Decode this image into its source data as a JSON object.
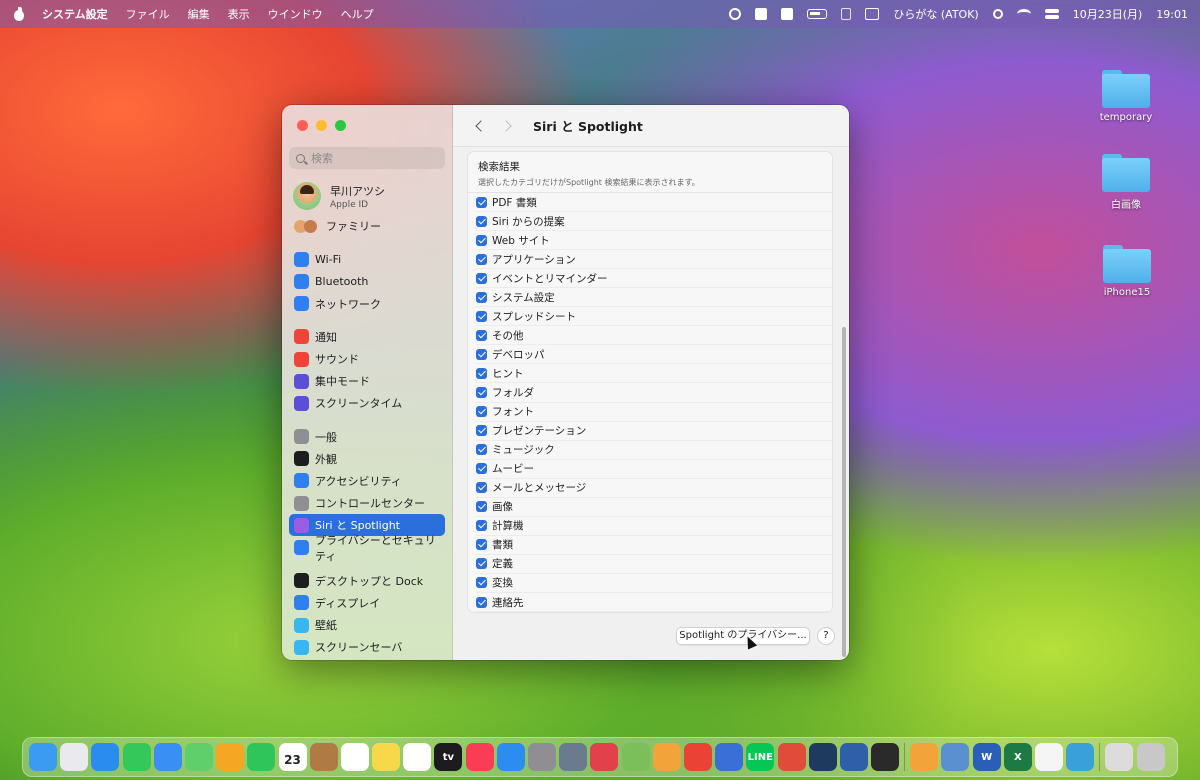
{
  "menubar": {
    "app": "システム設定",
    "items": [
      "ファイル",
      "編集",
      "表示",
      "ウインドウ",
      "ヘルプ"
    ],
    "input_method": "ひらがな (ATOK)",
    "date": "10月23日(月)",
    "time": "19:01"
  },
  "desktop": {
    "icons": [
      {
        "label": "temporary"
      },
      {
        "label": "白画像"
      },
      {
        "label": "iPhone15"
      }
    ]
  },
  "sidebar": {
    "search_placeholder": "検索",
    "user": {
      "name": "早川アツシ",
      "sub": "Apple ID"
    },
    "family": "ファミリー",
    "groups": [
      [
        {
          "label": "Wi-Fi",
          "icon": "wifi-icon",
          "color": "#2f7ff0"
        },
        {
          "label": "Bluetooth",
          "icon": "bluetooth-icon",
          "color": "#2f7ff0"
        },
        {
          "label": "ネットワーク",
          "icon": "globe-icon",
          "color": "#2f7ff0"
        }
      ],
      [
        {
          "label": "通知",
          "icon": "bell-icon",
          "color": "#f0443a"
        },
        {
          "label": "サウンド",
          "icon": "speaker-icon",
          "color": "#f0443a"
        },
        {
          "label": "集中モード",
          "icon": "moon-icon",
          "color": "#5a4fd6"
        },
        {
          "label": "スクリーンタイム",
          "icon": "hourglass-icon",
          "color": "#5a4fd6"
        }
      ],
      [
        {
          "label": "一般",
          "icon": "gear-icon",
          "color": "#8e8e93"
        },
        {
          "label": "外観",
          "icon": "appearance-icon",
          "color": "#1d1d1f"
        },
        {
          "label": "アクセシビリティ",
          "icon": "accessibility-icon",
          "color": "#2f7ff0"
        },
        {
          "label": "コントロールセンター",
          "icon": "control-center-icon",
          "color": "#8e8e93"
        },
        {
          "label": "Siri と Spotlight",
          "icon": "siri-icon",
          "color": "#9b5de5",
          "selected": true
        },
        {
          "label": "プライバシーとセキュリティ",
          "icon": "hand-icon",
          "color": "#2f7ff0"
        }
      ],
      [
        {
          "label": "デスクトップと Dock",
          "icon": "dock-icon",
          "color": "#1d1d1f"
        },
        {
          "label": "ディスプレイ",
          "icon": "sun-icon",
          "color": "#2f7ff0"
        },
        {
          "label": "壁紙",
          "icon": "wallpaper-icon",
          "color": "#38b6f0"
        },
        {
          "label": "スクリーンセーバ",
          "icon": "screensaver-icon",
          "color": "#38b6f0"
        }
      ]
    ]
  },
  "main": {
    "title": "Siri と Spotlight",
    "section_title": "検索結果",
    "section_desc": "選択したカテゴリだけがSpotlight 検索結果に表示されます。",
    "categories": [
      {
        "label": "PDF 書類",
        "checked": true
      },
      {
        "label": "Siri からの提案",
        "checked": true
      },
      {
        "label": "Web サイト",
        "checked": true
      },
      {
        "label": "アプリケーション",
        "checked": true
      },
      {
        "label": "イベントとリマインダー",
        "checked": true
      },
      {
        "label": "システム設定",
        "checked": true
      },
      {
        "label": "スプレッドシート",
        "checked": true
      },
      {
        "label": "その他",
        "checked": true
      },
      {
        "label": "デベロッパ",
        "checked": true
      },
      {
        "label": "ヒント",
        "checked": true
      },
      {
        "label": "フォルダ",
        "checked": true
      },
      {
        "label": "フォント",
        "checked": true
      },
      {
        "label": "プレゼンテーション",
        "checked": true
      },
      {
        "label": "ミュージック",
        "checked": true
      },
      {
        "label": "ムービー",
        "checked": true
      },
      {
        "label": "メールとメッセージ",
        "checked": true
      },
      {
        "label": "画像",
        "checked": true
      },
      {
        "label": "計算機",
        "checked": true
      },
      {
        "label": "書類",
        "checked": true
      },
      {
        "label": "定義",
        "checked": true
      },
      {
        "label": "変換",
        "checked": true
      },
      {
        "label": "連絡先",
        "checked": true
      }
    ],
    "privacy_button": "Spotlight のプライバシー...",
    "help_button": "?"
  },
  "dock": {
    "apps": [
      {
        "name": "finder-icon",
        "color": "#3a9bf0"
      },
      {
        "name": "launchpad-icon",
        "color": "#e9e9ee"
      },
      {
        "name": "safari-icon",
        "color": "#2b8cf0"
      },
      {
        "name": "messages-icon",
        "color": "#34c759"
      },
      {
        "name": "mail-icon",
        "color": "#3a8ff5"
      },
      {
        "name": "maps-icon",
        "color": "#5fcf6a"
      },
      {
        "name": "photos-icon",
        "color": "#f5a623"
      },
      {
        "name": "facetime-icon",
        "color": "#30c55a"
      },
      {
        "name": "calendar-icon",
        "color": "#ffffff",
        "text": "23"
      },
      {
        "name": "notes-app-icon",
        "color": "#b07a45"
      },
      {
        "name": "reminders-icon",
        "color": "#ffffff"
      },
      {
        "name": "notes-icon",
        "color": "#f7d84a"
      },
      {
        "name": "freeform-icon",
        "color": "#ffffff"
      },
      {
        "name": "appletv-icon",
        "color": "#1c1c1e",
        "text": "tv"
      },
      {
        "name": "music-icon",
        "color": "#fa3c55"
      },
      {
        "name": "appstore-icon",
        "color": "#2d8cf0"
      },
      {
        "name": "system-settings-icon",
        "color": "#8e8e93"
      },
      {
        "name": "preview-icon",
        "color": "#6b7a8c"
      },
      {
        "name": "app-1-icon",
        "color": "#e0414a"
      },
      {
        "name": "app-2-icon",
        "color": "#7bbf5a"
      },
      {
        "name": "app-3-icon",
        "color": "#f2a33a"
      },
      {
        "name": "chrome-icon",
        "color": "#ea4335"
      },
      {
        "name": "app-4-icon",
        "color": "#3a6fd8"
      },
      {
        "name": "line-icon",
        "color": "#06c755",
        "text": "LINE"
      },
      {
        "name": "app-5-icon",
        "color": "#e04b3a"
      },
      {
        "name": "app-6-icon",
        "color": "#1e3a5f"
      },
      {
        "name": "app-7-icon",
        "color": "#2f5fa8"
      },
      {
        "name": "terminal-icon",
        "color": "#2a2a2a"
      }
    ],
    "recent": [
      {
        "name": "app-8-icon",
        "color": "#f2a33a"
      },
      {
        "name": "app-9-icon",
        "color": "#5a8fd0"
      },
      {
        "name": "word-icon",
        "color": "#2b5eb8",
        "text": "W"
      },
      {
        "name": "excel-icon",
        "color": "#1e7a45",
        "text": "X"
      },
      {
        "name": "textedit-icon",
        "color": "#f5f5f5"
      },
      {
        "name": "quicktime-icon",
        "color": "#3aa0d8"
      }
    ],
    "end": [
      {
        "name": "downloads-icon",
        "color": "#dcdcdc"
      },
      {
        "name": "trash-icon",
        "color": "#c8c8c8"
      }
    ]
  }
}
